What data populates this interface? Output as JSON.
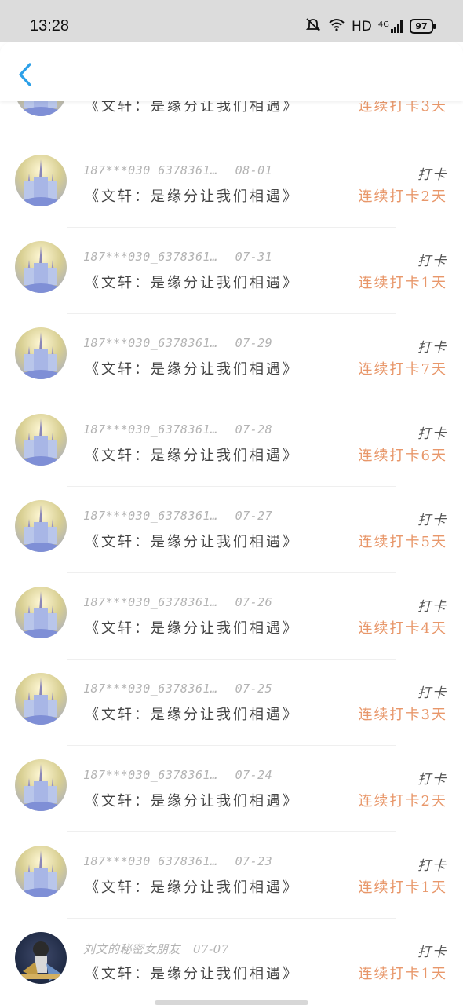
{
  "status_bar": {
    "time": "13:28",
    "network": "HD",
    "signal_type": "4G",
    "battery": "97",
    "icons": [
      "mute-icon",
      "wifi-icon",
      "signal-icon",
      "battery-icon"
    ]
  },
  "nav": {
    "back_icon": "chevron-left-icon",
    "accent": "#2ca0e8"
  },
  "colors": {
    "streak": "#e8976a",
    "meta": "#b3b3b3"
  },
  "entries": [
    {
      "user": "",
      "date": "",
      "title": "《文轩：是缘分让我们相遇》",
      "tag": "",
      "streak": "连续打卡3天",
      "avatar": "castle"
    },
    {
      "user": "187***030_6378361…",
      "date": "08-01",
      "title": "《文轩：是缘分让我们相遇》",
      "tag": "打卡",
      "streak": "连续打卡2天",
      "avatar": "castle"
    },
    {
      "user": "187***030_6378361…",
      "date": "07-31",
      "title": "《文轩：是缘分让我们相遇》",
      "tag": "打卡",
      "streak": "连续打卡1天",
      "avatar": "castle"
    },
    {
      "user": "187***030_6378361…",
      "date": "07-29",
      "title": "《文轩：是缘分让我们相遇》",
      "tag": "打卡",
      "streak": "连续打卡7天",
      "avatar": "castle"
    },
    {
      "user": "187***030_6378361…",
      "date": "07-28",
      "title": "《文轩：是缘分让我们相遇》",
      "tag": "打卡",
      "streak": "连续打卡6天",
      "avatar": "castle"
    },
    {
      "user": "187***030_6378361…",
      "date": "07-27",
      "title": "《文轩：是缘分让我们相遇》",
      "tag": "打卡",
      "streak": "连续打卡5天",
      "avatar": "castle"
    },
    {
      "user": "187***030_6378361…",
      "date": "07-26",
      "title": "《文轩：是缘分让我们相遇》",
      "tag": "打卡",
      "streak": "连续打卡4天",
      "avatar": "castle"
    },
    {
      "user": "187***030_6378361…",
      "date": "07-25",
      "title": "《文轩：是缘分让我们相遇》",
      "tag": "打卡",
      "streak": "连续打卡3天",
      "avatar": "castle"
    },
    {
      "user": "187***030_6378361…",
      "date": "07-24",
      "title": "《文轩：是缘分让我们相遇》",
      "tag": "打卡",
      "streak": "连续打卡2天",
      "avatar": "castle"
    },
    {
      "user": "187***030_6378361…",
      "date": "07-23",
      "title": "《文轩：是缘分让我们相遇》",
      "tag": "打卡",
      "streak": "连续打卡1天",
      "avatar": "castle"
    },
    {
      "user": "刘文的秘密女朋友",
      "date": "07-07",
      "title": "《文轩：是缘分让我们相遇》",
      "tag": "打卡",
      "streak": "连续打卡1天",
      "avatar": "person"
    }
  ]
}
